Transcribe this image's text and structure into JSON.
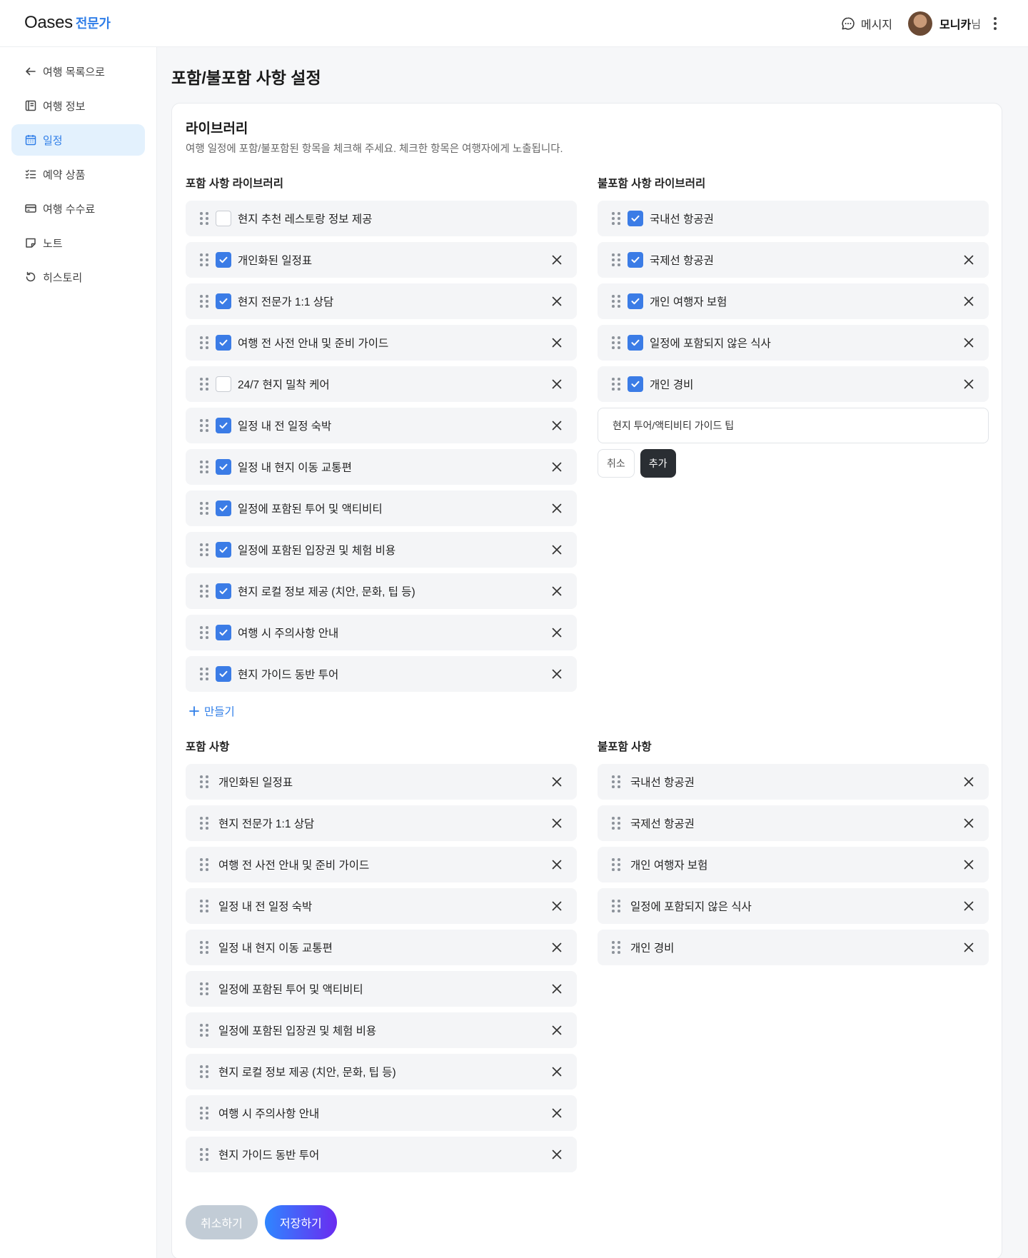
{
  "header": {
    "logo": "Oases",
    "logo_sub": "전문가",
    "message_label": "메시지",
    "user_name": "모니카",
    "user_suffix": "님"
  },
  "sidebar": {
    "items": [
      {
        "label": "여행 목록으로",
        "icon": "arrow-left-icon"
      },
      {
        "label": "여행 정보",
        "icon": "document-icon"
      },
      {
        "label": "일정",
        "icon": "calendar-icon",
        "active": true
      },
      {
        "label": "예약 상품",
        "icon": "checklist-icon"
      },
      {
        "label": "여행 수수료",
        "icon": "credit-card-icon"
      },
      {
        "label": "노트",
        "icon": "note-icon"
      },
      {
        "label": "히스토리",
        "icon": "history-icon"
      }
    ]
  },
  "page": {
    "title": "포함/불포함 사항 설정",
    "card_title": "라이브러리",
    "card_desc": "여행 일정에 포함/불포함된 항목을 체크해 주세요. 체크한 항목은 여행자에게 노출됩니다."
  },
  "include_library": {
    "title": "포함 사항 라이브러리",
    "items": [
      {
        "label": "현지 추천 레스토랑 정보 제공",
        "checked": false,
        "removable": false
      },
      {
        "label": "개인화된 일정표",
        "checked": true,
        "removable": true
      },
      {
        "label": "현지 전문가 1:1 상담",
        "checked": true,
        "removable": true
      },
      {
        "label": "여행 전 사전 안내 및 준비 가이드",
        "checked": true,
        "removable": true
      },
      {
        "label": "24/7 현지 밀착 케어",
        "checked": false,
        "removable": true
      },
      {
        "label": "일정 내 전 일정 숙박",
        "checked": true,
        "removable": true
      },
      {
        "label": "일정 내 현지 이동 교통편",
        "checked": true,
        "removable": true
      },
      {
        "label": "일정에 포함된 투어 및 액티비티",
        "checked": true,
        "removable": true
      },
      {
        "label": "일정에 포함된 입장권 및 체험 비용",
        "checked": true,
        "removable": true
      },
      {
        "label": "현지 로컬 정보 제공 (치안, 문화, 팁 등)",
        "checked": true,
        "removable": true
      },
      {
        "label": "여행 시 주의사항 안내",
        "checked": true,
        "removable": true
      },
      {
        "label": "현지 가이드 동반 투어",
        "checked": true,
        "removable": true
      }
    ],
    "create_label": "만들기"
  },
  "exclude_library": {
    "title": "불포함 사항 라이브러리",
    "items": [
      {
        "label": "국내선 항공권",
        "checked": true,
        "removable": false
      },
      {
        "label": "국제선 항공권",
        "checked": true,
        "removable": true
      },
      {
        "label": "개인 여행자 보험",
        "checked": true,
        "removable": true
      },
      {
        "label": "일정에 포함되지 않은 식사",
        "checked": true,
        "removable": true
      },
      {
        "label": "개인 경비",
        "checked": true,
        "removable": true
      }
    ],
    "new_item_value": "현지 투어/액티비티 가이드 팁",
    "cancel_label": "취소",
    "add_label": "추가"
  },
  "include_selected": {
    "title": "포함 사항",
    "items": [
      "개인화된 일정표",
      "현지 전문가 1:1 상담",
      "여행 전 사전 안내 및 준비 가이드",
      "일정 내 전 일정 숙박",
      "일정 내 현지 이동 교통편",
      "일정에 포함된 투어 및 액티비티",
      "일정에 포함된 입장권 및 체험 비용",
      "현지 로컬 정보 제공 (치안, 문화, 팁 등)",
      "여행 시 주의사항 안내",
      "현지 가이드 동반 투어"
    ]
  },
  "exclude_selected": {
    "title": "불포함 사항",
    "items": [
      "국내선 항공권",
      "국제선 항공권",
      "개인 여행자 보험",
      "일정에 포함되지 않은 식사",
      "개인 경비"
    ]
  },
  "footer": {
    "cancel_label": "취소하기",
    "save_label": "저장하기"
  },
  "colors": {
    "accent": "#2f7ee8",
    "checkbox": "#3b7ce6",
    "active_nav_bg": "#e3f1fd"
  }
}
